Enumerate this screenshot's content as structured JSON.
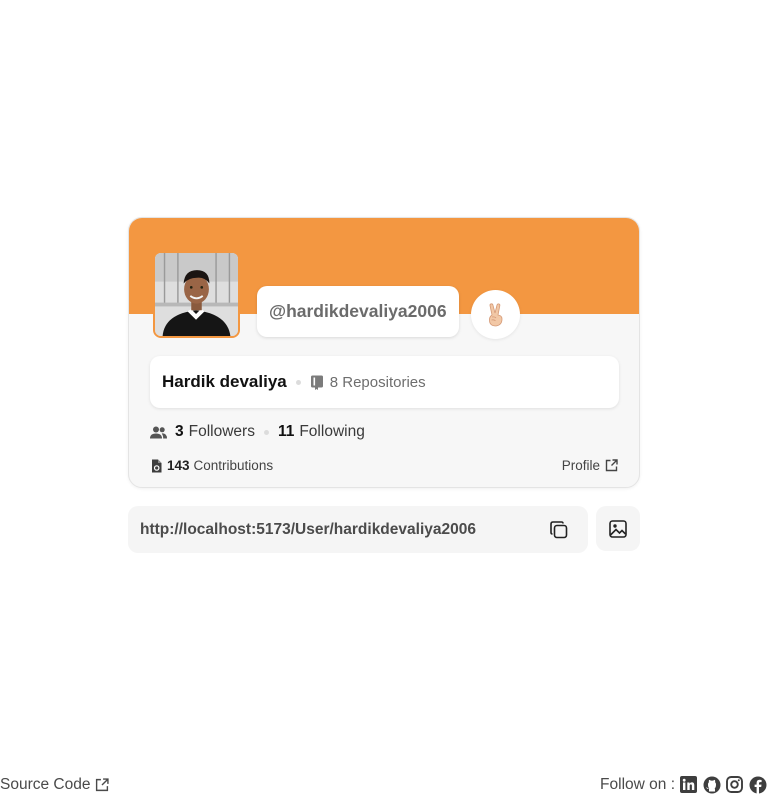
{
  "profile_card": {
    "username": "@hardikdevaliya2006",
    "name": "Hardik devaliya",
    "repositories": "8 Repositories",
    "followers_count": "3",
    "followers_label": "Followers",
    "following_count": "11",
    "following_label": "Following",
    "contributions_count": "143",
    "contributions_label": "Contributions",
    "profile_link_label": "Profile",
    "banner_color": "#f39741",
    "emoji": "✌🏻"
  },
  "share": {
    "url": "http://localhost:5173/User/hardikdevaliya2006"
  },
  "footer": {
    "source_code_label": "Source Code",
    "follow_label": "Follow on :",
    "socials": [
      "linkedin-icon",
      "github-icon",
      "instagram-icon",
      "facebook-icon"
    ]
  }
}
